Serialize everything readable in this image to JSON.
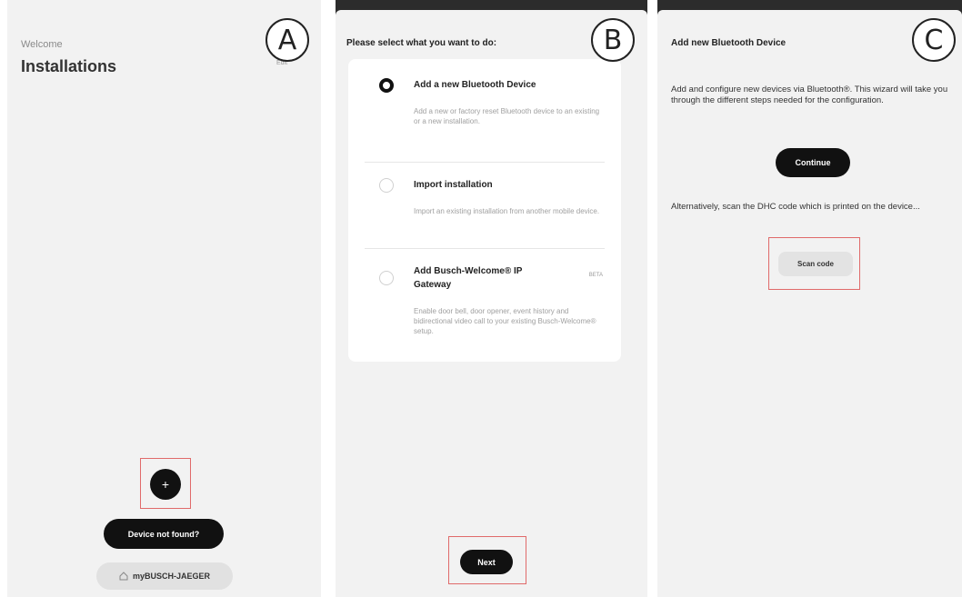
{
  "panels": {
    "a": {
      "step_label": "A",
      "welcome": "Welcome",
      "title": "Installations",
      "corner_text": "Edit",
      "add_button": "+",
      "device_not_found": "Device not found?",
      "mybusch_icon": "house-icon",
      "mybusch": "myBUSCH-JAEGER"
    },
    "b": {
      "step_label": "B",
      "heading": "Please select what you want to do:",
      "options": [
        {
          "title": "Add a new Bluetooth Device",
          "description": "Add a new or factory reset Bluetooth device to an existing or a new installation.",
          "selected": true
        },
        {
          "title": "Import installation",
          "description": "Import an existing installation from another mobile device.",
          "selected": false
        },
        {
          "title": "Add Busch-Welcome® IP Gateway",
          "badge": "BETA",
          "description": "Enable door bell, door opener, event history and bidirectional video call to your existing Busch-Welcome® setup.",
          "selected": false
        }
      ],
      "next_button": "Next"
    },
    "c": {
      "step_label": "C",
      "heading": "Add new Bluetooth Device",
      "paragraph1": "Add and configure new devices via Bluetooth®. This wizard will take you through the different steps needed for the configuration.",
      "continue_button": "Continue",
      "paragraph2": "Alternatively, scan the DHC code which is printed on the device...",
      "scan_button": "Scan code"
    }
  },
  "colors": {
    "highlight": "#e06a6a",
    "dark_button": "#111111",
    "panel_bg": "#f0f0f0"
  }
}
